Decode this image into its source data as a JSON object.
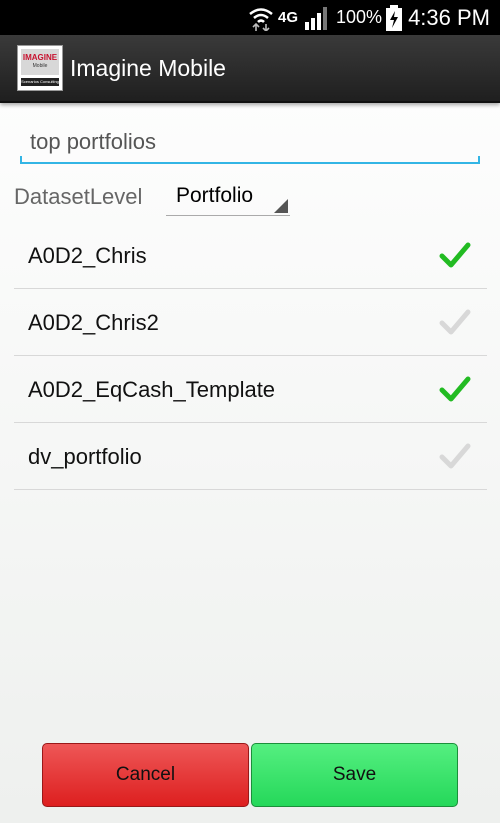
{
  "status_bar": {
    "network": "4G",
    "battery": "100%",
    "time": "4:36 PM"
  },
  "app": {
    "title": "Imagine Mobile",
    "logo_text": "IMAGINE",
    "logo_subtext": "Mobile",
    "logo_footer": "Scenarios  Consulting"
  },
  "search": {
    "value": "top portfolios"
  },
  "dataset": {
    "label": "DatasetLevel",
    "selected": "Portfolio"
  },
  "portfolios": [
    {
      "name": "A0D2_Chris",
      "checked": true
    },
    {
      "name": "A0D2_Chris2",
      "checked": false
    },
    {
      "name": "A0D2_EqCash_Template",
      "checked": true
    },
    {
      "name": "dv_portfolio",
      "checked": false
    }
  ],
  "buttons": {
    "cancel": "Cancel",
    "save": "Save"
  },
  "colors": {
    "check_on": "#22bb22",
    "check_off": "#d8d8d8",
    "accent": "#33b5e5"
  }
}
